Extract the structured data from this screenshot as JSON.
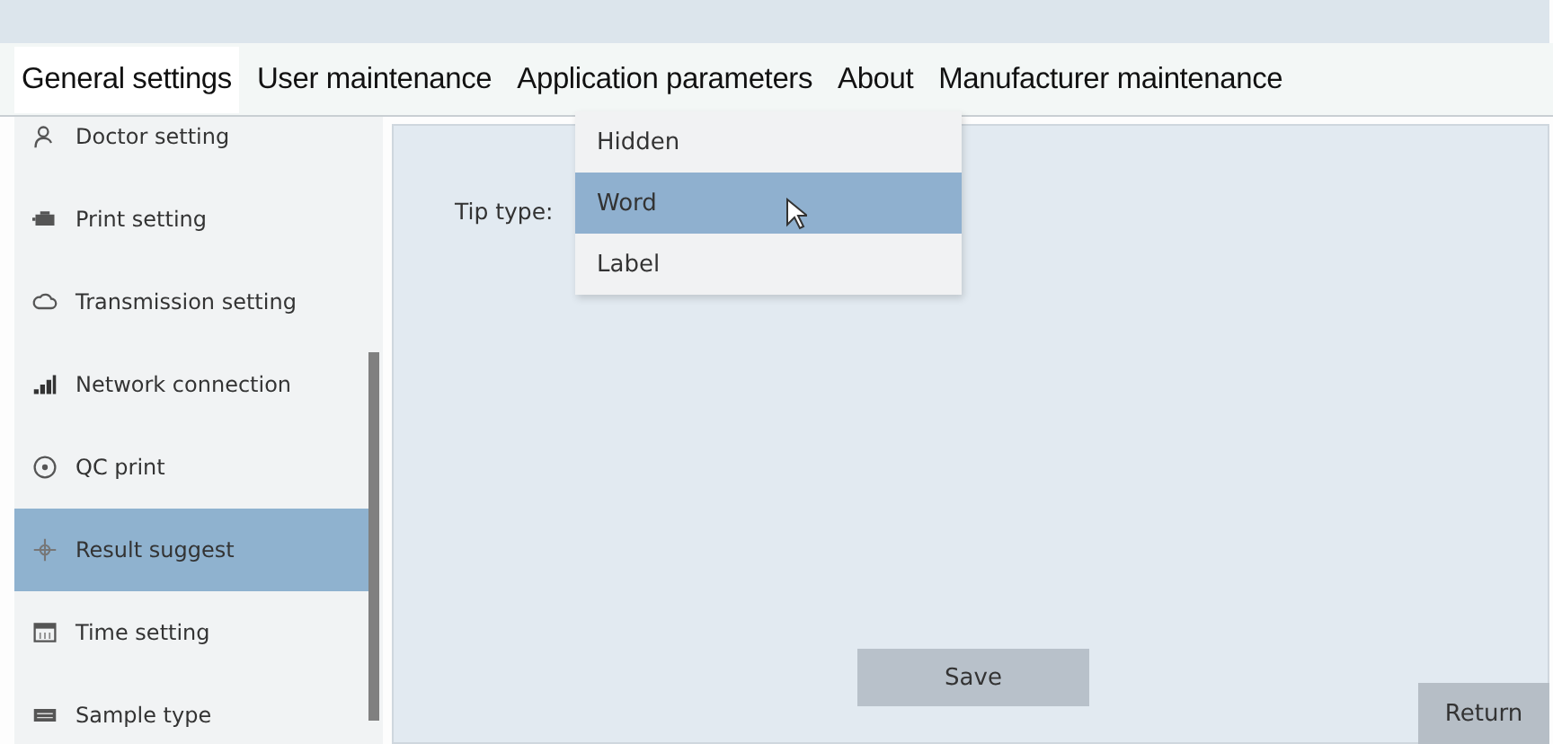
{
  "tabs": [
    {
      "label": "General settings",
      "selected": true
    },
    {
      "label": "User maintenance",
      "selected": false
    },
    {
      "label": "Application parameters",
      "selected": false
    },
    {
      "label": "About",
      "selected": false
    },
    {
      "label": "Manufacturer maintenance",
      "selected": false
    }
  ],
  "sidebar": {
    "items": [
      {
        "label": "Doctor setting",
        "selected": false
      },
      {
        "label": "Print setting",
        "selected": false
      },
      {
        "label": "Transmission setting",
        "selected": false
      },
      {
        "label": "Network connection",
        "selected": false
      },
      {
        "label": "QC print",
        "selected": false
      },
      {
        "label": "Result suggest",
        "selected": true
      },
      {
        "label": "Time setting",
        "selected": false
      },
      {
        "label": "Sample type",
        "selected": false
      }
    ]
  },
  "form": {
    "tip_type": {
      "label": "Tip type:",
      "options": [
        {
          "label": "Hidden",
          "selected": false
        },
        {
          "label": "Word",
          "selected": true
        },
        {
          "label": "Label",
          "selected": false
        }
      ]
    }
  },
  "buttons": {
    "save": "Save",
    "return": "Return"
  }
}
